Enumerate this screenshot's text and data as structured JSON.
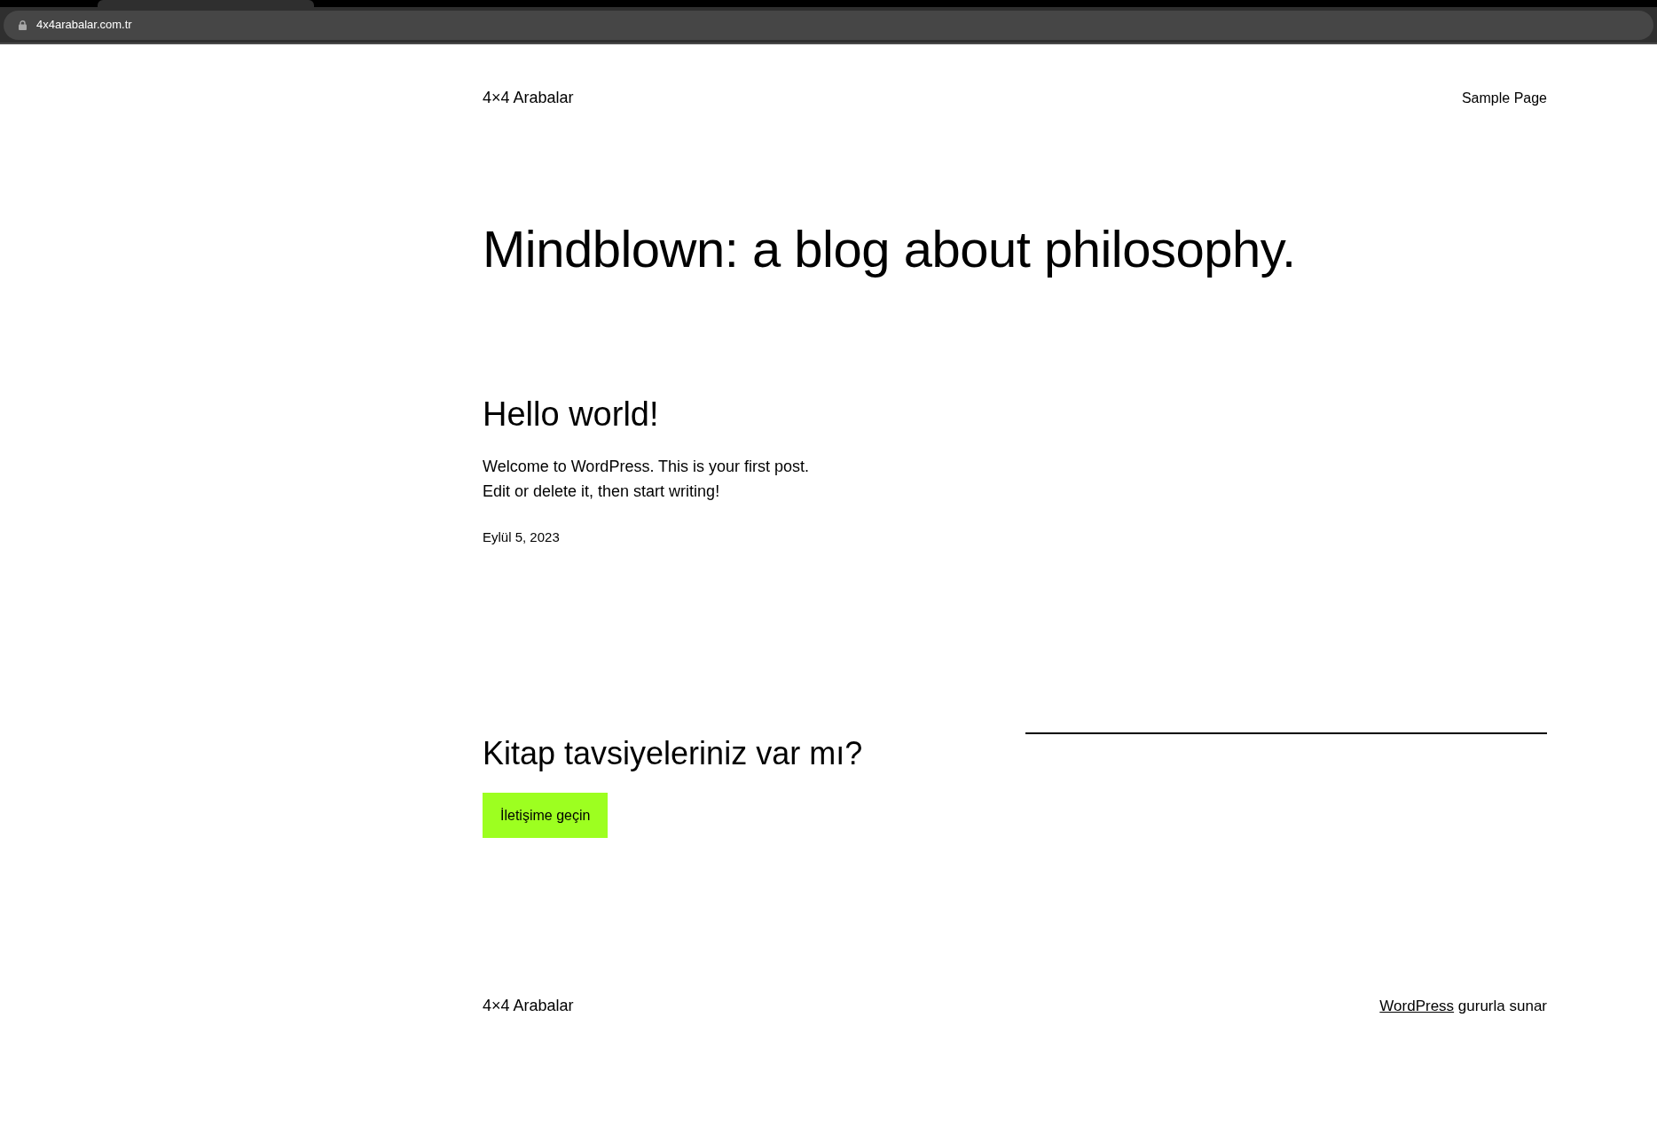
{
  "browser": {
    "url": "4x4arabalar.com.tr"
  },
  "header": {
    "site_title": "4×4 Arabalar",
    "nav": [
      {
        "label": "Sample Page"
      }
    ]
  },
  "page_title": "Mindblown: a blog about philosophy.",
  "posts": [
    {
      "title": "Hello world!",
      "excerpt": "Welcome to WordPress. This is your first post. Edit or delete it, then start writing!",
      "date": "Eylül 5, 2023"
    }
  ],
  "cta": {
    "heading": "Kitap tavsiyeleriniz var mı?",
    "button": "İletişime geçin"
  },
  "footer": {
    "site_title": "4×4 Arabalar",
    "credit": {
      "link": "WordPress",
      "text": "gururla sunar"
    }
  }
}
